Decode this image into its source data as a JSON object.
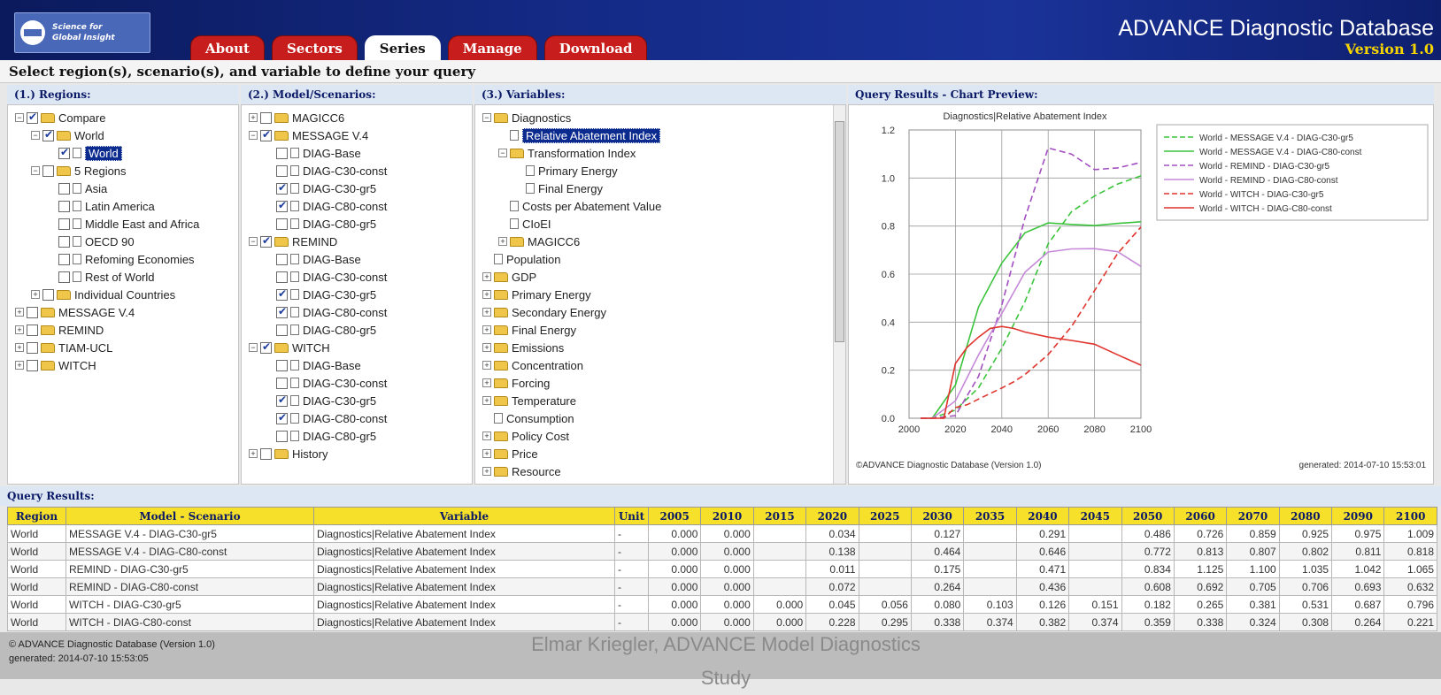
{
  "header": {
    "logo_line1": "Science for",
    "logo_line2": "Global Insight",
    "tabs": [
      {
        "label": "About",
        "active": false
      },
      {
        "label": "Sectors",
        "active": false
      },
      {
        "label": "Series",
        "active": true
      },
      {
        "label": "Manage",
        "active": false
      },
      {
        "label": "Download",
        "active": false
      }
    ],
    "title": "ADVANCE Diagnostic Database",
    "version": "Version 1.0"
  },
  "instruction": "Select region(s), scenario(s), and variable to define your query",
  "panels": {
    "regions": {
      "title": "(1.) Regions:",
      "rows": [
        {
          "indent": 0,
          "exp": "−",
          "chk": true,
          "icon": "folder",
          "label": "Compare"
        },
        {
          "indent": 1,
          "exp": "−",
          "chk": true,
          "icon": "folder",
          "label": "World"
        },
        {
          "indent": 2,
          "exp": "",
          "chk": true,
          "icon": "doc",
          "label": "World",
          "selected": true
        },
        {
          "indent": 1,
          "exp": "−",
          "chk": false,
          "icon": "folder",
          "label": "5 Regions"
        },
        {
          "indent": 2,
          "exp": "",
          "chk": false,
          "icon": "doc",
          "label": "Asia"
        },
        {
          "indent": 2,
          "exp": "",
          "chk": false,
          "icon": "doc",
          "label": "Latin America"
        },
        {
          "indent": 2,
          "exp": "",
          "chk": false,
          "icon": "doc",
          "label": "Middle East and Africa"
        },
        {
          "indent": 2,
          "exp": "",
          "chk": false,
          "icon": "doc",
          "label": "OECD 90"
        },
        {
          "indent": 2,
          "exp": "",
          "chk": false,
          "icon": "doc",
          "label": "Refoming Economies"
        },
        {
          "indent": 2,
          "exp": "",
          "chk": false,
          "icon": "doc",
          "label": "Rest of World"
        },
        {
          "indent": 1,
          "exp": "+",
          "chk": false,
          "icon": "folder",
          "label": "Individual Countries"
        },
        {
          "indent": 0,
          "exp": "+",
          "chk": false,
          "icon": "folder",
          "label": "MESSAGE V.4"
        },
        {
          "indent": 0,
          "exp": "+",
          "chk": false,
          "icon": "folder",
          "label": "REMIND"
        },
        {
          "indent": 0,
          "exp": "+",
          "chk": false,
          "icon": "folder",
          "label": "TIAM-UCL"
        },
        {
          "indent": 0,
          "exp": "+",
          "chk": false,
          "icon": "folder",
          "label": "WITCH"
        }
      ]
    },
    "models": {
      "title": "(2.) Model/Scenarios:",
      "rows": [
        {
          "indent": 0,
          "exp": "+",
          "chk": false,
          "icon": "folder",
          "label": "MAGICC6"
        },
        {
          "indent": 0,
          "exp": "−",
          "chk": true,
          "icon": "folder",
          "label": "MESSAGE V.4"
        },
        {
          "indent": 1,
          "exp": "",
          "chk": false,
          "icon": "doc",
          "label": "DIAG-Base"
        },
        {
          "indent": 1,
          "exp": "",
          "chk": false,
          "icon": "doc",
          "label": "DIAG-C30-const"
        },
        {
          "indent": 1,
          "exp": "",
          "chk": true,
          "icon": "doc",
          "label": "DIAG-C30-gr5"
        },
        {
          "indent": 1,
          "exp": "",
          "chk": true,
          "icon": "doc",
          "label": "DIAG-C80-const"
        },
        {
          "indent": 1,
          "exp": "",
          "chk": false,
          "icon": "doc",
          "label": "DIAG-C80-gr5"
        },
        {
          "indent": 0,
          "exp": "−",
          "chk": true,
          "icon": "folder",
          "label": "REMIND"
        },
        {
          "indent": 1,
          "exp": "",
          "chk": false,
          "icon": "doc",
          "label": "DIAG-Base"
        },
        {
          "indent": 1,
          "exp": "",
          "chk": false,
          "icon": "doc",
          "label": "DIAG-C30-const"
        },
        {
          "indent": 1,
          "exp": "",
          "chk": true,
          "icon": "doc",
          "label": "DIAG-C30-gr5"
        },
        {
          "indent": 1,
          "exp": "",
          "chk": true,
          "icon": "doc",
          "label": "DIAG-C80-const"
        },
        {
          "indent": 1,
          "exp": "",
          "chk": false,
          "icon": "doc",
          "label": "DIAG-C80-gr5"
        },
        {
          "indent": 0,
          "exp": "−",
          "chk": true,
          "icon": "folder",
          "label": "WITCH"
        },
        {
          "indent": 1,
          "exp": "",
          "chk": false,
          "icon": "doc",
          "label": "DIAG-Base"
        },
        {
          "indent": 1,
          "exp": "",
          "chk": false,
          "icon": "doc",
          "label": "DIAG-C30-const"
        },
        {
          "indent": 1,
          "exp": "",
          "chk": true,
          "icon": "doc",
          "label": "DIAG-C30-gr5"
        },
        {
          "indent": 1,
          "exp": "",
          "chk": true,
          "icon": "doc",
          "label": "DIAG-C80-const"
        },
        {
          "indent": 1,
          "exp": "",
          "chk": false,
          "icon": "doc",
          "label": "DIAG-C80-gr5"
        },
        {
          "indent": 0,
          "exp": "+",
          "chk": false,
          "icon": "folder",
          "label": "History"
        }
      ]
    },
    "variables": {
      "title": "(3.) Variables:",
      "rows": [
        {
          "indent": 0,
          "exp": "−",
          "icon": "folder",
          "label": "Diagnostics"
        },
        {
          "indent": 1,
          "exp": "",
          "icon": "doc",
          "label": "Relative Abatement Index",
          "selected": true
        },
        {
          "indent": 1,
          "exp": "−",
          "icon": "folder",
          "label": "Transformation Index"
        },
        {
          "indent": 2,
          "exp": "",
          "icon": "doc",
          "label": "Primary Energy"
        },
        {
          "indent": 2,
          "exp": "",
          "icon": "doc",
          "label": "Final Energy"
        },
        {
          "indent": 1,
          "exp": "",
          "icon": "doc",
          "label": "Costs per Abatement Value"
        },
        {
          "indent": 1,
          "exp": "",
          "icon": "doc",
          "label": "CIoEI"
        },
        {
          "indent": 1,
          "exp": "+",
          "icon": "folder",
          "label": "MAGICC6"
        },
        {
          "indent": 0,
          "exp": "",
          "icon": "doc",
          "label": "Population"
        },
        {
          "indent": 0,
          "exp": "+",
          "icon": "folder",
          "label": "GDP"
        },
        {
          "indent": 0,
          "exp": "+",
          "icon": "folder",
          "label": "Primary Energy"
        },
        {
          "indent": 0,
          "exp": "+",
          "icon": "folder",
          "label": "Secondary Energy"
        },
        {
          "indent": 0,
          "exp": "+",
          "icon": "folder",
          "label": "Final Energy"
        },
        {
          "indent": 0,
          "exp": "+",
          "icon": "folder",
          "label": "Emissions"
        },
        {
          "indent": 0,
          "exp": "+",
          "icon": "folder",
          "label": "Concentration"
        },
        {
          "indent": 0,
          "exp": "+",
          "icon": "folder",
          "label": "Forcing"
        },
        {
          "indent": 0,
          "exp": "+",
          "icon": "folder",
          "label": "Temperature"
        },
        {
          "indent": 0,
          "exp": "",
          "icon": "doc",
          "label": "Consumption"
        },
        {
          "indent": 0,
          "exp": "+",
          "icon": "folder",
          "label": "Policy Cost"
        },
        {
          "indent": 0,
          "exp": "+",
          "icon": "folder",
          "label": "Price"
        },
        {
          "indent": 0,
          "exp": "+",
          "icon": "folder",
          "label": "Resource"
        }
      ]
    },
    "chart": {
      "title": "Query Results - Chart Preview:",
      "copyright": "©ADVANCE Diagnostic Database (Version 1.0)",
      "generated": "generated: 2014-07-10 15:53:01"
    }
  },
  "chart_data": {
    "type": "line",
    "title": "Diagnostics|Relative Abatement Index",
    "xlabel": "",
    "ylabel": "",
    "xlim": [
      2000,
      2100
    ],
    "ylim": [
      0,
      1.2
    ],
    "xticks": [
      "2000",
      "2020",
      "2040",
      "2060",
      "2080",
      "2100"
    ],
    "yticks": [
      "0.0",
      "0.2",
      "0.4",
      "0.6",
      "0.8",
      "1.0",
      "1.2"
    ],
    "grid": true,
    "legend_position": "right",
    "series": [
      {
        "name": "World - MESSAGE V.4 - DIAG-C30-gr5",
        "color": "#3cc43c",
        "dash": true,
        "points": [
          [
            2005,
            0.0
          ],
          [
            2010,
            0.0
          ],
          [
            2020,
            0.034
          ],
          [
            2030,
            0.127
          ],
          [
            2040,
            0.291
          ],
          [
            2050,
            0.486
          ],
          [
            2060,
            0.726
          ],
          [
            2070,
            0.859
          ],
          [
            2080,
            0.925
          ],
          [
            2090,
            0.975
          ],
          [
            2100,
            1.009
          ]
        ]
      },
      {
        "name": "World - MESSAGE V.4 - DIAG-C80-const",
        "color": "#3cc43c",
        "dash": false,
        "points": [
          [
            2005,
            0.0
          ],
          [
            2010,
            0.0
          ],
          [
            2020,
            0.138
          ],
          [
            2030,
            0.464
          ],
          [
            2040,
            0.646
          ],
          [
            2050,
            0.772
          ],
          [
            2060,
            0.813
          ],
          [
            2070,
            0.807
          ],
          [
            2080,
            0.802
          ],
          [
            2090,
            0.811
          ],
          [
            2100,
            0.818
          ]
        ]
      },
      {
        "name": "World - REMIND - DIAG-C30-gr5",
        "color": "#a24fc0",
        "dash": true,
        "points": [
          [
            2005,
            0.0
          ],
          [
            2010,
            0.0
          ],
          [
            2020,
            0.011
          ],
          [
            2030,
            0.175
          ],
          [
            2040,
            0.471
          ],
          [
            2050,
            0.834
          ],
          [
            2060,
            1.125
          ],
          [
            2070,
            1.1
          ],
          [
            2080,
            1.035
          ],
          [
            2090,
            1.042
          ],
          [
            2100,
            1.065
          ]
        ]
      },
      {
        "name": "World - REMIND - DIAG-C80-const",
        "color": "#c68ad8",
        "dash": false,
        "points": [
          [
            2005,
            0.0
          ],
          [
            2010,
            0.0
          ],
          [
            2020,
            0.072
          ],
          [
            2030,
            0.264
          ],
          [
            2040,
            0.436
          ],
          [
            2050,
            0.608
          ],
          [
            2060,
            0.692
          ],
          [
            2070,
            0.705
          ],
          [
            2080,
            0.706
          ],
          [
            2090,
            0.693
          ],
          [
            2100,
            0.632
          ]
        ]
      },
      {
        "name": "World - WITCH - DIAG-C30-gr5",
        "color": "#e0342e",
        "dash": true,
        "points": [
          [
            2005,
            0.0
          ],
          [
            2010,
            0.0
          ],
          [
            2015,
            0.0
          ],
          [
            2020,
            0.045
          ],
          [
            2025,
            0.056
          ],
          [
            2030,
            0.08
          ],
          [
            2035,
            0.103
          ],
          [
            2040,
            0.126
          ],
          [
            2045,
            0.151
          ],
          [
            2050,
            0.182
          ],
          [
            2060,
            0.265
          ],
          [
            2070,
            0.381
          ],
          [
            2080,
            0.531
          ],
          [
            2090,
            0.687
          ],
          [
            2100,
            0.796
          ]
        ]
      },
      {
        "name": "World - WITCH - DIAG-C80-const",
        "color": "#e0342e",
        "dash": false,
        "points": [
          [
            2005,
            0.0
          ],
          [
            2010,
            0.0
          ],
          [
            2015,
            0.0
          ],
          [
            2020,
            0.228
          ],
          [
            2025,
            0.295
          ],
          [
            2030,
            0.338
          ],
          [
            2035,
            0.374
          ],
          [
            2040,
            0.382
          ],
          [
            2045,
            0.374
          ],
          [
            2050,
            0.359
          ],
          [
            2060,
            0.338
          ],
          [
            2070,
            0.324
          ],
          [
            2080,
            0.308
          ],
          [
            2090,
            0.264
          ],
          [
            2100,
            0.221
          ]
        ]
      }
    ]
  },
  "results": {
    "title": "Query Results:",
    "columns": [
      "Region",
      "Model - Scenario",
      "Variable",
      "Unit",
      "2005",
      "2010",
      "2015",
      "2020",
      "2025",
      "2030",
      "2035",
      "2040",
      "2045",
      "2050",
      "2060",
      "2070",
      "2080",
      "2090",
      "2100"
    ],
    "rows": [
      [
        "World",
        "MESSAGE V.4 - DIAG-C30-gr5",
        "Diagnostics|Relative Abatement Index",
        "-",
        "0.000",
        "0.000",
        "",
        "0.034",
        "",
        "0.127",
        "",
        "0.291",
        "",
        "0.486",
        "0.726",
        "0.859",
        "0.925",
        "0.975",
        "1.009"
      ],
      [
        "World",
        "MESSAGE V.4 - DIAG-C80-const",
        "Diagnostics|Relative Abatement Index",
        "-",
        "0.000",
        "0.000",
        "",
        "0.138",
        "",
        "0.464",
        "",
        "0.646",
        "",
        "0.772",
        "0.813",
        "0.807",
        "0.802",
        "0.811",
        "0.818"
      ],
      [
        "World",
        "REMIND - DIAG-C30-gr5",
        "Diagnostics|Relative Abatement Index",
        "-",
        "0.000",
        "0.000",
        "",
        "0.011",
        "",
        "0.175",
        "",
        "0.471",
        "",
        "0.834",
        "1.125",
        "1.100",
        "1.035",
        "1.042",
        "1.065"
      ],
      [
        "World",
        "REMIND - DIAG-C80-const",
        "Diagnostics|Relative Abatement Index",
        "-",
        "0.000",
        "0.000",
        "",
        "0.072",
        "",
        "0.264",
        "",
        "0.436",
        "",
        "0.608",
        "0.692",
        "0.705",
        "0.706",
        "0.693",
        "0.632"
      ],
      [
        "World",
        "WITCH - DIAG-C30-gr5",
        "Diagnostics|Relative Abatement Index",
        "-",
        "0.000",
        "0.000",
        "0.000",
        "0.045",
        "0.056",
        "0.080",
        "0.103",
        "0.126",
        "0.151",
        "0.182",
        "0.265",
        "0.381",
        "0.531",
        "0.687",
        "0.796"
      ],
      [
        "World",
        "WITCH - DIAG-C80-const",
        "Diagnostics|Relative Abatement Index",
        "-",
        "0.000",
        "0.000",
        "0.000",
        "0.228",
        "0.295",
        "0.338",
        "0.374",
        "0.382",
        "0.374",
        "0.359",
        "0.338",
        "0.324",
        "0.308",
        "0.264",
        "0.221"
      ]
    ]
  },
  "footer": {
    "copyright": "© ADVANCE Diagnostic Database (Version 1.0)",
    "generated": "generated: 2014-07-10 15:53:05"
  },
  "overlay_caption_line1": "Elmar Kriegler, ADVANCE Model Diagnostics",
  "overlay_caption_line2": "Study"
}
